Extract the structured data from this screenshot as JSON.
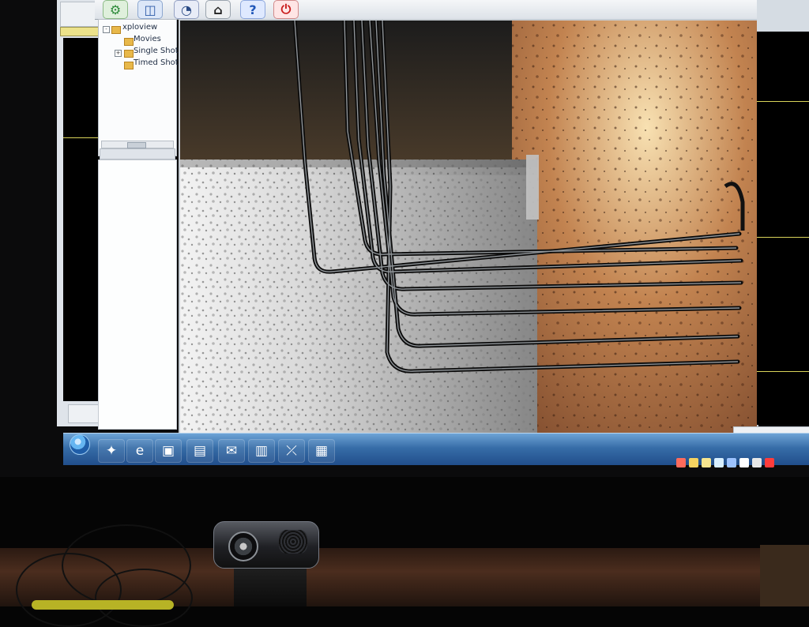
{
  "app": {
    "title": "xploview"
  },
  "toolbar": {
    "buttons": [
      {
        "icon": "gear-icon"
      },
      {
        "icon": "camera-icon"
      },
      {
        "icon": "record-icon"
      },
      {
        "icon": "printer-icon"
      },
      {
        "icon": "help-icon"
      },
      {
        "icon": "power-icon"
      }
    ]
  },
  "tree": {
    "root": "xploview",
    "items": [
      "Movies",
      "Single Shot",
      "Timed Shot"
    ]
  },
  "taskbar": {
    "icons": [
      {
        "icon": "start-icon"
      },
      {
        "icon": "app-icon"
      },
      {
        "icon": "browser-icon"
      },
      {
        "icon": "folder-icon"
      },
      {
        "icon": "monitor-icon"
      },
      {
        "icon": "mail-icon"
      },
      {
        "icon": "files-icon"
      },
      {
        "icon": "tool-icon"
      },
      {
        "icon": "media-icon"
      }
    ]
  },
  "colors": {
    "taskbar": "#2a5e98",
    "viewport_border": "#c7cdd3",
    "yellow_line": "#d9d45a"
  }
}
